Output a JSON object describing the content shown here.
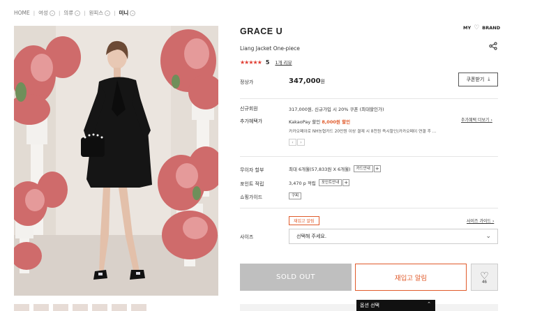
{
  "breadcrumb": {
    "items": [
      "HOME",
      "여성",
      "의류",
      "원피스",
      "미니"
    ]
  },
  "product": {
    "title": "GRACE U",
    "subtitle": "Liang Jacket One-piece",
    "stars": "★★★★★",
    "rating": "5",
    "review_count": "1개 리뷰",
    "brand_nav": {
      "my": "MY",
      "brand": "BRAND"
    }
  },
  "price": {
    "label": "정상가",
    "value": "347,000",
    "unit": "원"
  },
  "coupon_button": "쿠폰받기",
  "benefits": {
    "new_member_label": "신규회원",
    "new_member_text": "317,000원, 신규가입 시 20% 쿠폰 (최대할인가)",
    "extra_label": "추가혜택가",
    "kakao_prefix": "KakaoPay 할인",
    "kakao_discount": "8,000원 할인",
    "kakao_detail": "카카오페이로 NH농협카드 20만원 이상 결제 시 8천원 즉시할인(카카오페이 연결 후 ...",
    "more_link": "추가혜택 더보기"
  },
  "installment": {
    "label": "무이자 할부",
    "text": "최대 6개월(57,833원 X 6개월)",
    "guide_btn": "카드안내"
  },
  "points": {
    "label": "포인트 적립",
    "text": "3,470 p 적립",
    "guide_btn": "포인트안내"
  },
  "shopping_guide": {
    "label": "쇼핑가이드",
    "tag": "구찌"
  },
  "size": {
    "restock_badge": "재입고 알림",
    "guide_link": "사이즈 가이드",
    "label": "사이즈",
    "placeholder": "선택해 주세요."
  },
  "actions": {
    "sold_out": "SOLD OUT",
    "restock": "재입고 알림",
    "wish_count": "46"
  },
  "option_tab": "옵션 선택",
  "colors": {
    "accent": "#e05a2a",
    "star": "#e03c31"
  }
}
